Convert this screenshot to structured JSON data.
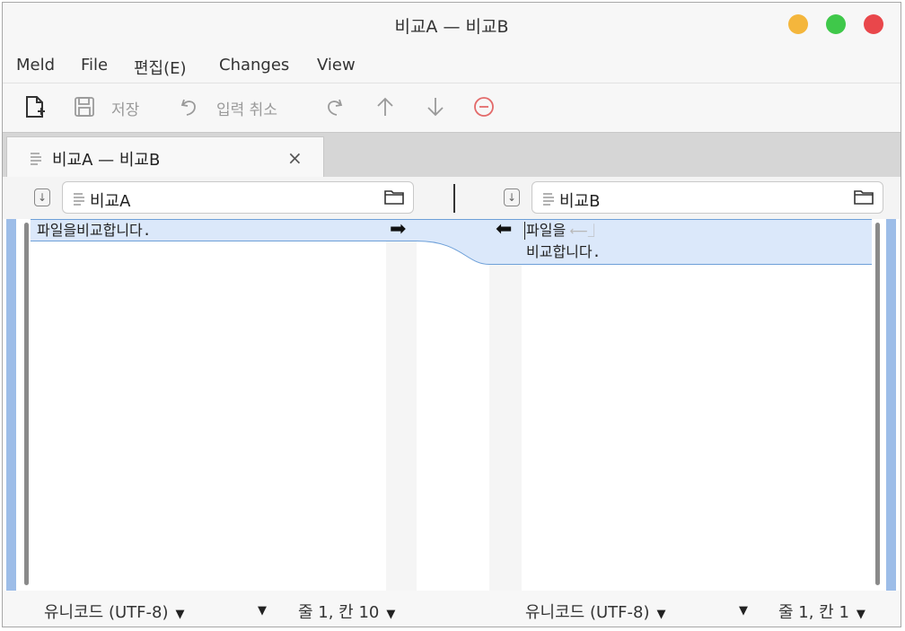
{
  "window": {
    "title": "비교A — 비교B"
  },
  "traffic_lights": {
    "minimize_color": "#f4b63c",
    "maximize_color": "#3fc84a",
    "close_color": "#e9474b"
  },
  "menu": {
    "items": [
      "Meld",
      "File",
      "편집(E)",
      "Changes",
      "View"
    ]
  },
  "toolbar": {
    "save_label": "저장",
    "undo_label": "입력 취소"
  },
  "tab": {
    "title": "비교A — 비교B",
    "close_glyph": "×"
  },
  "left": {
    "file_name": "비교A",
    "lines": [
      "파일을비교합니다."
    ],
    "status": {
      "encoding": "유니코드 (UTF-8)",
      "position": "줄 1, 칸 10"
    }
  },
  "right": {
    "file_name": "비교B",
    "lines": [
      "파일을",
      "비교합니다."
    ],
    "status": {
      "encoding": "유니코드 (UTF-8)",
      "position": "줄 1, 칸 1"
    }
  },
  "colors": {
    "diff_fill": "#dbe8fa",
    "diff_border": "#6ea0d8",
    "stop_icon": "#e36a6a"
  }
}
